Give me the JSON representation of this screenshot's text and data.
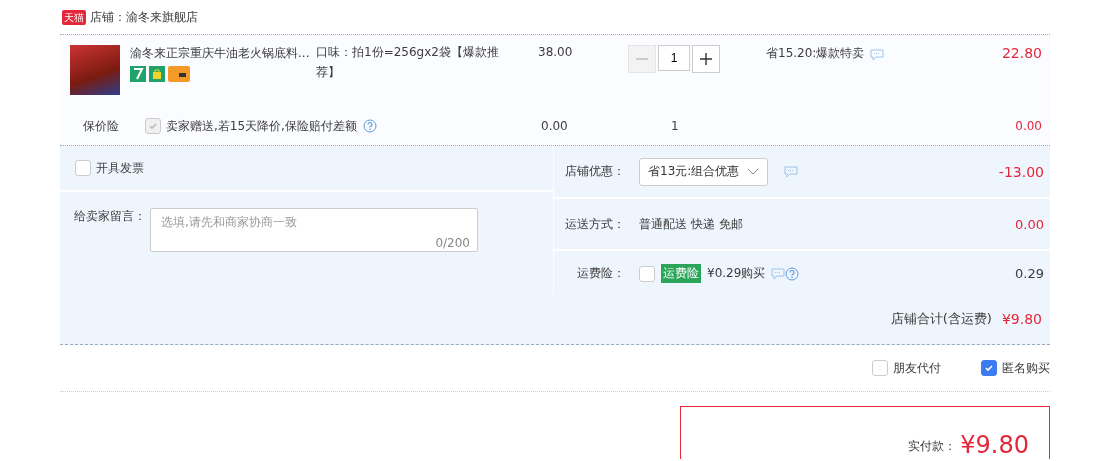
{
  "shop": {
    "badge": "天猫",
    "name": "店铺：渝冬来旗舰店"
  },
  "item": {
    "title": "渝冬来正宗重庆牛油老火锅底料...",
    "attribute": "口味：拍1份=256gx2袋【爆款推荐】",
    "price": "38.00",
    "quantity": "1",
    "discount": "省15.20:爆款特卖",
    "subtotal": "22.80"
  },
  "insurance": {
    "label": "保价险",
    "checked": true,
    "disabled": true,
    "text": "卖家赠送,若15天降价,保险赔付差额",
    "price": "0.00",
    "quantity": "1",
    "subtotal": "0.00"
  },
  "invoice": {
    "label": "开具发票",
    "checked": false
  },
  "message": {
    "label": "给卖家留言：",
    "placeholder": "选填,请先和商家协商一致",
    "counter": "0/200"
  },
  "shop_discount": {
    "label": "店铺优惠：",
    "option": "省13元:组合优惠",
    "amount": "-13.00"
  },
  "shipping": {
    "label": "运送方式：",
    "method": "普通配送 快递 免邮",
    "amount": "0.00"
  },
  "freight_insurance": {
    "label": "运费险：",
    "checked": false,
    "tag": "运费险",
    "price": "¥0.29购买",
    "amount": "0.29"
  },
  "shop_total": {
    "label": "店铺合计(含运费)",
    "amount": "¥9.80"
  },
  "options": [
    {
      "label": "朋友代付",
      "checked": false
    },
    {
      "label": "匿名购买",
      "checked": true
    }
  ],
  "payment": {
    "label": "实付款：",
    "amount": "¥9.80"
  }
}
